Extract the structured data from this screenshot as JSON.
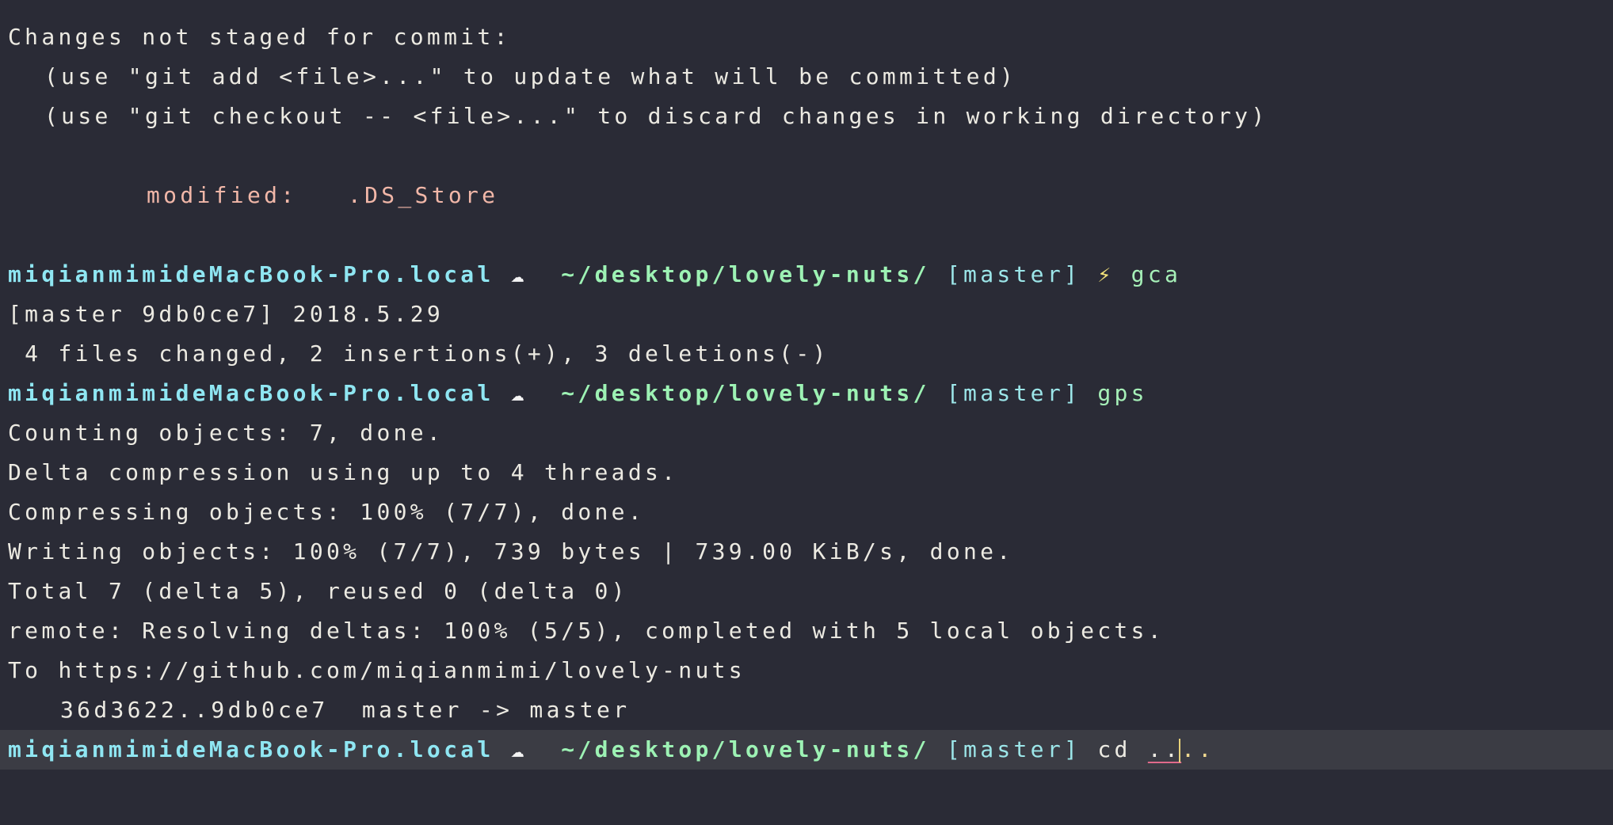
{
  "status": {
    "header": "Changes not staged for commit:",
    "hint_add": "(use \"git add <file>...\" to update what will be committed)",
    "hint_checkout": "(use \"git checkout -- <file>...\" to discard changes in working directory)",
    "modified_label": "modified:",
    "modified_file": ".DS_Store"
  },
  "prompt": {
    "host": "miqianmimideMacBook-Pro.local",
    "cloud_icon": "☁",
    "path": "~/desktop/lovely-nuts/",
    "branch": "[master]",
    "bolt_icon": "⚡"
  },
  "commands": {
    "gca": "gca",
    "gps": "gps",
    "cd": "cd",
    "cd_arg_underlined": "..",
    "cd_arg_rest": ".."
  },
  "commit_output": {
    "line1": "[master 9db0ce7] 2018.5.29",
    "line2": " 4 files changed, 2 insertions(+), 3 deletions(-)"
  },
  "push_output": {
    "counting": "Counting objects: 7, done.",
    "delta": "Delta compression using up to 4 threads.",
    "compressing": "Compressing objects: 100% (7/7), done.",
    "writing": "Writing objects: 100% (7/7), 739 bytes | 739.00 KiB/s, done.",
    "total": "Total 7 (delta 5), reused 0 (delta 0)",
    "remote": "remote: Resolving deltas: 100% (5/5), completed with 5 local objects.",
    "to": "To https://github.com/miqianmimi/lovely-nuts",
    "refs": "36d3622..9db0ce7  master -> master"
  }
}
